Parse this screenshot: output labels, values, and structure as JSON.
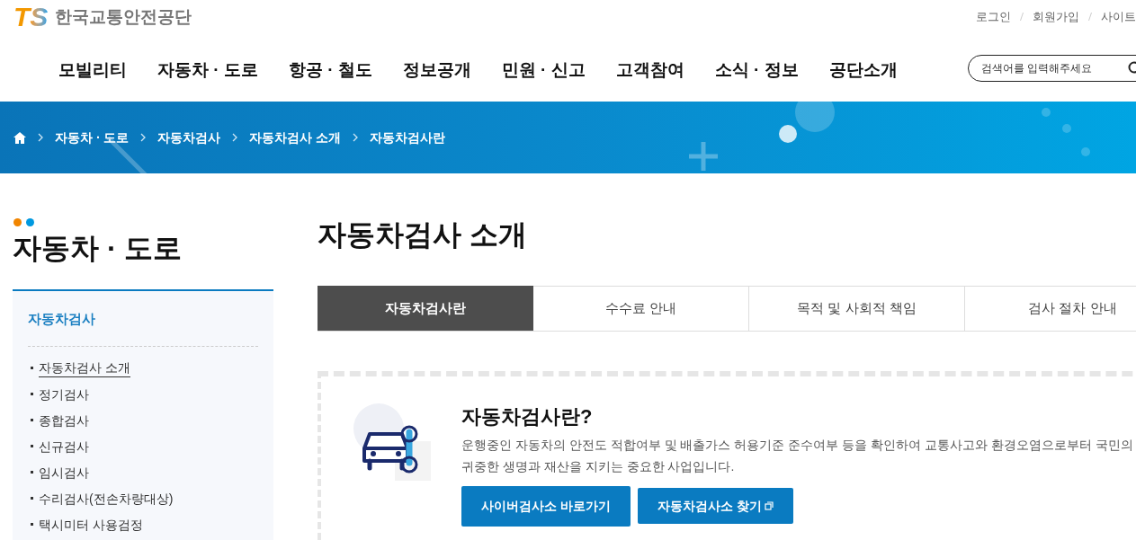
{
  "header": {
    "logo": {
      "mark": "TS",
      "name": "한국교통안전공단"
    },
    "util_links": [
      "로그인",
      "회원가입",
      "사이트"
    ],
    "nav": [
      "모빌리티",
      "자동차 · 도로",
      "항공 · 철도",
      "정보공개",
      "민원 · 신고",
      "고객참여",
      "소식 · 정보",
      "공단소개"
    ],
    "search": {
      "placeholder": "검색어를 입력해주세요"
    }
  },
  "breadcrumb": [
    "자동차 · 도로",
    "자동차검사",
    "자동차검사 소개",
    "자동차검사란"
  ],
  "sidebar": {
    "title": "자동차 · 도로",
    "section": "자동차검사",
    "items": [
      {
        "label": "자동차검사 소개",
        "selected": true
      },
      {
        "label": "정기검사",
        "selected": false
      },
      {
        "label": "종합검사",
        "selected": false
      },
      {
        "label": "신규검사",
        "selected": false
      },
      {
        "label": "임시검사",
        "selected": false
      },
      {
        "label": "수리검사(전손차량대상)",
        "selected": false
      },
      {
        "label": "택시미터 사용검정",
        "selected": false
      }
    ]
  },
  "page_title": "자동차검사 소개",
  "tabs": [
    {
      "label": "자동차검사란",
      "selected": true
    },
    {
      "label": "수수료 안내",
      "selected": false
    },
    {
      "label": "목적 및 사회적 책임",
      "selected": false
    },
    {
      "label": "검사 절차 안내",
      "selected": false
    }
  ],
  "intro": {
    "heading": "자동차검사란?",
    "text": "운행중인 자동차의 안전도 적합여부 및 배출가스 허용기준 준수여부 등을 확인하여 교통사고와 환경오염으로부터 국민의 귀중한 생명과 재산을 지키는 중요한 사업입니다.",
    "buttons": [
      {
        "label": "사이버검사소 바로가기",
        "external": false
      },
      {
        "label": "자동차검사소 찾기",
        "external": true
      }
    ]
  }
}
